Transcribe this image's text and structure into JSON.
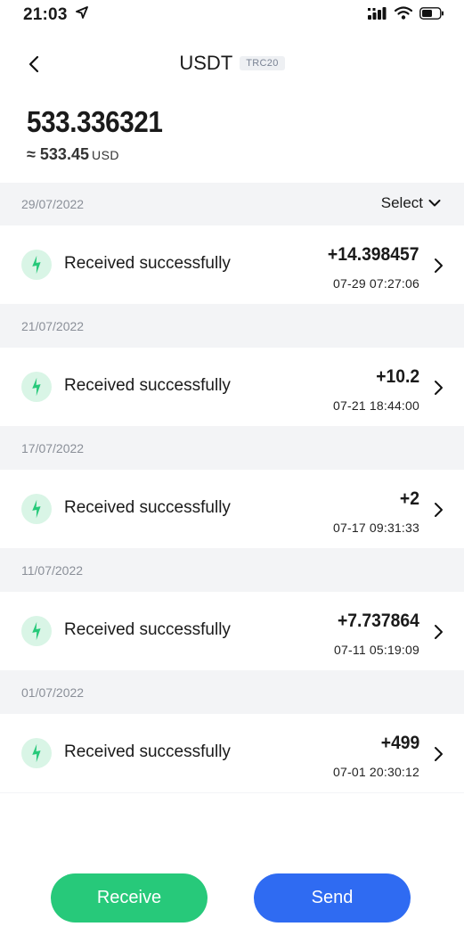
{
  "status": {
    "time": "21:03"
  },
  "nav": {
    "title": "USDT",
    "badge": "TRC20"
  },
  "balance": {
    "amount": "533.336321",
    "fiat_prefix": "≈",
    "fiat_value": "533.45",
    "fiat_unit": "USD"
  },
  "filter": {
    "select_label": "Select"
  },
  "groups": [
    {
      "date": "29/07/2022",
      "tx": {
        "label": "Received successfully",
        "amount": "+14.398457",
        "time": "07-29  07:27:06"
      }
    },
    {
      "date": "21/07/2022",
      "tx": {
        "label": "Received successfully",
        "amount": "+10.2",
        "time": "07-21  18:44:00"
      }
    },
    {
      "date": "17/07/2022",
      "tx": {
        "label": "Received successfully",
        "amount": "+2",
        "time": "07-17  09:31:33"
      }
    },
    {
      "date": "11/07/2022",
      "tx": {
        "label": "Received successfully",
        "amount": "+7.737864",
        "time": "07-11  05:19:09"
      }
    },
    {
      "date": "01/07/2022",
      "tx": {
        "label": "Received successfully",
        "amount": "+499",
        "time": "07-01  20:30:12"
      }
    }
  ],
  "actions": {
    "receive_label": "Receive",
    "send_label": "Send"
  },
  "colors": {
    "receive": "#27c97a",
    "send": "#2f6bf2",
    "success_icon": "#27c97a",
    "section_bg": "#f3f4f6"
  }
}
